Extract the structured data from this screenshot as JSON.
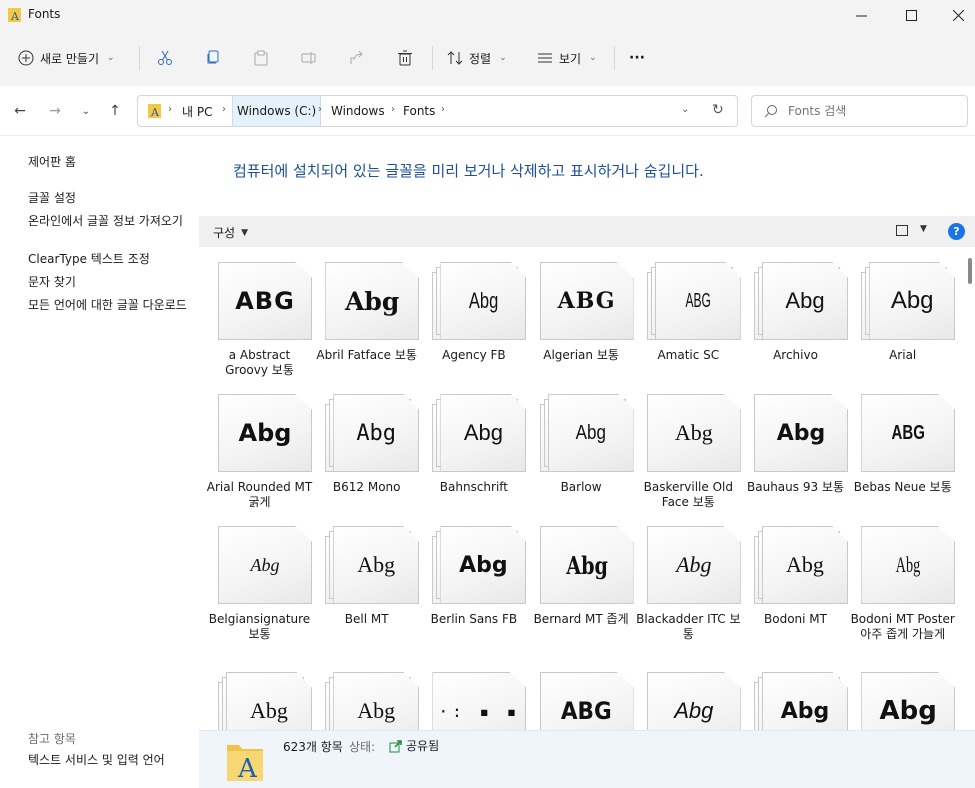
{
  "window": {
    "title": "Fonts"
  },
  "toolbar": {
    "new_label": "새로 만들기",
    "sort_label": "정렬",
    "view_label": "보기",
    "more_label": "···"
  },
  "address": {
    "crumbs": [
      "내 PC",
      "Windows (C:)",
      "Windows",
      "Fonts"
    ],
    "search_placeholder": "Fonts 검색"
  },
  "left_pane": {
    "control_panel_home": "제어판 홈",
    "links": [
      "글꼴 설정",
      "온라인에서 글꼴 정보 가져오기",
      "ClearType 텍스트 조정",
      "문자 찾기",
      "모든 언어에 대한 글꼴 다운로드"
    ],
    "see_also_header": "참고 항목",
    "see_also": [
      "텍스트 서비스 및 입력 언어"
    ]
  },
  "main": {
    "headline": "컴퓨터에 설치되어 있는 글꼴을 미리 보거나 삭제하고 표시하거나 숨깁니다.",
    "organize_label": "구성",
    "help_label": "?"
  },
  "fonts": [
    {
      "name": "a Abstract Groovy 보통",
      "sample": "ABG",
      "stack": false
    },
    {
      "name": "Abril Fatface 보통",
      "sample": "Abg",
      "stack": false
    },
    {
      "name": "Agency FB",
      "sample": "Abg",
      "stack": true
    },
    {
      "name": "Algerian 보통",
      "sample": "ABG",
      "stack": false
    },
    {
      "name": "Amatic SC",
      "sample": "ABG",
      "stack": true
    },
    {
      "name": "Archivo",
      "sample": "Abg",
      "stack": true
    },
    {
      "name": "Arial",
      "sample": "Abg",
      "stack": true
    },
    {
      "name": "Arial Rounded MT 굵게",
      "sample": "Abg",
      "stack": false
    },
    {
      "name": "B612 Mono",
      "sample": "Abg",
      "stack": true
    },
    {
      "name": "Bahnschrift",
      "sample": "Abg",
      "stack": true
    },
    {
      "name": "Barlow",
      "sample": "Abg",
      "stack": true
    },
    {
      "name": "Baskerville Old Face 보통",
      "sample": "Abg",
      "stack": false
    },
    {
      "name": "Bauhaus 93 보통",
      "sample": "Abg",
      "stack": false
    },
    {
      "name": "Bebas Neue 보통",
      "sample": "ABG",
      "stack": false
    },
    {
      "name": "Belgiansignature 보통",
      "sample": "Abg",
      "stack": false
    },
    {
      "name": "Bell MT",
      "sample": "Abg",
      "stack": true
    },
    {
      "name": "Berlin Sans FB",
      "sample": "Abg",
      "stack": true
    },
    {
      "name": "Bernard MT 좁게",
      "sample": "Abg",
      "stack": false
    },
    {
      "name": "Blackadder ITC 보통",
      "sample": "Abg",
      "stack": false
    },
    {
      "name": "Bodoni MT",
      "sample": "Abg",
      "stack": true
    },
    {
      "name": "Bodoni MT Poster 아주 좁게 가늘게",
      "sample": "Abg",
      "stack": false
    },
    {
      "name": "",
      "sample": "Abg",
      "stack": true
    },
    {
      "name": "",
      "sample": "Abg",
      "stack": true
    },
    {
      "name": "",
      "sample": "·: ▪ ▪",
      "stack": false
    },
    {
      "name": "",
      "sample": "ABG",
      "stack": false
    },
    {
      "name": "",
      "sample": "Abg",
      "stack": false
    },
    {
      "name": "",
      "sample": "Abg",
      "stack": true
    },
    {
      "name": "",
      "sample": "Abg",
      "stack": false
    }
  ],
  "status": {
    "count": "623개 항목",
    "state_label": "상태:",
    "state_value": "공유됨"
  }
}
